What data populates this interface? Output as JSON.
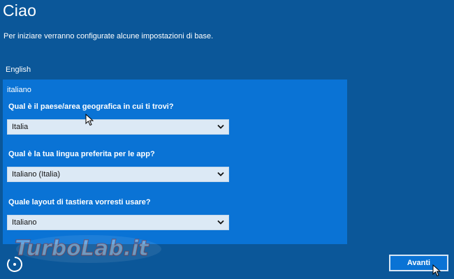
{
  "page": {
    "title": "Ciao",
    "subtitle": "Per iniziare verranno configurate alcune impostazioni di base."
  },
  "language_list": {
    "option_english": "English",
    "option_selected": "italiano"
  },
  "settings": {
    "country": {
      "question": "Qual è il paese/area geografica in cui ti trovi?",
      "value": "Italia"
    },
    "app_language": {
      "question": "Qual è la tua lingua preferita per le app?",
      "value": "Italiano (Italia)"
    },
    "keyboard": {
      "question": "Quale layout di tastiera vorresti usare?",
      "value": "Italiano"
    }
  },
  "footer": {
    "next_label": "Avanti"
  },
  "watermark": {
    "text": "TurboLab.it"
  },
  "icons": {
    "chevron": "chevron-down-icon",
    "accessibility": "ease-of-access-icon",
    "cursor": "mouse-pointer-icon"
  },
  "colors": {
    "background": "#0b5799",
    "panel": "#0a73d5",
    "dropdown": "#dce9f5"
  }
}
